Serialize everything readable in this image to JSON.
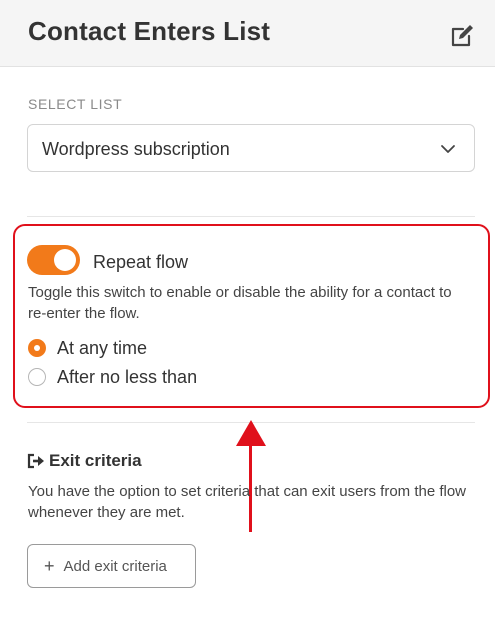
{
  "header": {
    "title": "Contact Enters List",
    "edit_icon": "edit-icon"
  },
  "select_list": {
    "label": "SELECT LIST",
    "value": "Wordpress subscription",
    "dropdown_icon": "chevron-down-icon"
  },
  "repeat_flow": {
    "enabled": true,
    "label": "Repeat flow",
    "description": "Toggle this switch to enable or disable the ability for a contact to re-enter the flow.",
    "options": [
      {
        "label": "At any time",
        "checked": true
      },
      {
        "label": "After no less than",
        "checked": false
      }
    ]
  },
  "exit_criteria": {
    "icon": "exit-icon",
    "title": "Exit criteria",
    "description": "You have the option to set criteria that can exit users from the flow whenever they are met.",
    "add_button_label": "Add exit criteria",
    "add_button_icon": "plus-icon"
  },
  "colors": {
    "accent": "#f27a1a",
    "annotation": "#e0101b"
  }
}
